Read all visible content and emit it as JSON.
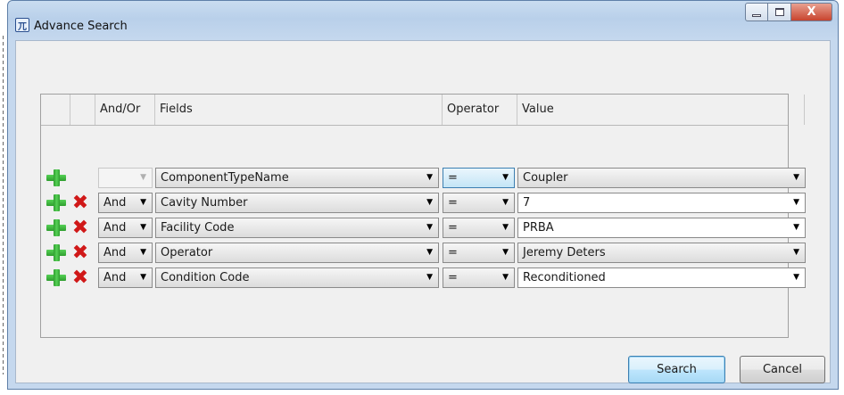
{
  "window": {
    "title": "Advance Search",
    "close_glyph": "X",
    "icon_glyph": "兀"
  },
  "grid": {
    "headers": [
      "And/Or",
      "Fields",
      "Operator",
      "Value"
    ],
    "rows": [
      {
        "andor": "",
        "field": "ComponentTypeName",
        "operator": "=",
        "value": "Coupler"
      },
      {
        "andor": "And",
        "field": "Cavity Number",
        "operator": "=",
        "value": "7"
      },
      {
        "andor": "And",
        "field": "Facility Code",
        "operator": "=",
        "value": "PRBA"
      },
      {
        "andor": "And",
        "field": "Operator",
        "operator": "=",
        "value": "Jeremy Deters"
      },
      {
        "andor": "And",
        "field": "Condition Code",
        "operator": "=",
        "value": "Reconditioned"
      }
    ]
  },
  "buttons": {
    "search": "Search",
    "cancel": "Cancel"
  },
  "icons": {
    "add": "plus-icon",
    "remove": "delete-x-icon",
    "dropdown": "chevron-down-icon"
  },
  "colors": {
    "add_green": "#3cb83c",
    "remove_red": "#d01818",
    "focus_blue": "#3c7fb1"
  }
}
